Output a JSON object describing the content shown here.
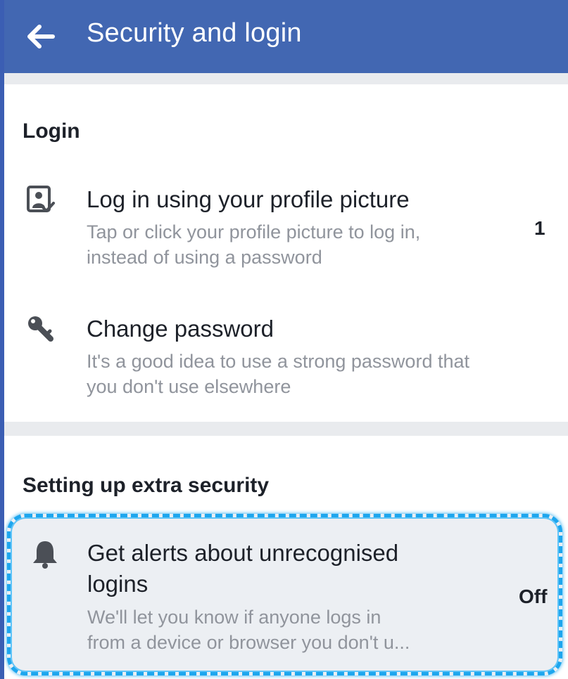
{
  "header": {
    "title": "Security and login",
    "back_icon": "arrow-left-icon"
  },
  "sections": {
    "login": {
      "title": "Login",
      "items": [
        {
          "icon": "profile-picture-login-icon",
          "title": "Log in using your profile picture",
          "subtitle_line1": "Tap or click your profile picture to log in,",
          "subtitle_line2": "instead of using a password",
          "value": "1"
        },
        {
          "icon": "key-icon",
          "title": "Change password",
          "subtitle_line1": "It's a good idea to use a strong password that",
          "subtitle_line2": "you don't use elsewhere"
        }
      ]
    },
    "extra_security": {
      "title": "Setting up extra security",
      "items": [
        {
          "icon": "bell-icon",
          "title_line1": "Get alerts about unrecognised",
          "title_line2": "logins",
          "subtitle_line1": "We'll let you know if anyone logs in",
          "subtitle_line2": "from a device or browser you don't u...",
          "value": "Off"
        }
      ]
    }
  },
  "colors": {
    "header_bg": "#4267b2",
    "highlight_border": "#1da6ee",
    "section_gap": "#e9ebee"
  }
}
